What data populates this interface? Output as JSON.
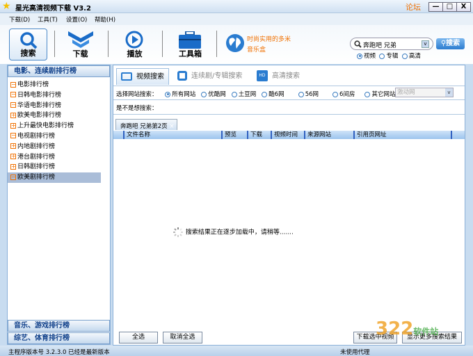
{
  "window": {
    "title": "星光高清视频下载 V3.2",
    "forum": "论坛",
    "minimize": "—",
    "maximize": "□",
    "close": "X"
  },
  "menu": [
    "下载(D)",
    "工具(T)",
    "设置(O)",
    "帮助(H)"
  ],
  "toolbar": {
    "search": "搜索",
    "download": "下载",
    "play": "播放",
    "toolbox": "工具箱",
    "promo_line1": "时尚实用的多米",
    "promo_line2": "音乐盒"
  },
  "search": {
    "value": "奔跑吧 兄弟",
    "button": "搜索",
    "types": [
      "视频",
      "专辑",
      "高清"
    ],
    "selected_type": "视频"
  },
  "sidebar": {
    "header_top": "电影、连续剧排行榜",
    "items": [
      {
        "label": "电影排行榜",
        "sign": "−"
      },
      {
        "label": "日韩电影排行榜",
        "sign": "−"
      },
      {
        "label": "华语电影排行榜",
        "sign": "−"
      },
      {
        "label": "欧美电影排行榜",
        "sign": "+"
      },
      {
        "label": "上升最快电影排行榜",
        "sign": "+"
      },
      {
        "label": "电视剧排行榜",
        "sign": "−"
      },
      {
        "label": "内地剧排行榜",
        "sign": "+"
      },
      {
        "label": "港台剧排行榜",
        "sign": "+"
      },
      {
        "label": "日韩剧排行榜",
        "sign": "+"
      },
      {
        "label": "欧美剧排行榜",
        "sign": "−"
      }
    ],
    "selected": "欧美剧排行榜",
    "header_music": "音乐、游戏排行榜",
    "header_variety": "综艺、体育排行榜"
  },
  "main": {
    "tabs": [
      "视频搜索",
      "连续剧/专辑搜索",
      "高清搜索"
    ],
    "site_label": "选择网站搜索：",
    "sites": [
      "所有网站",
      "优酷网",
      "土豆网",
      "酷6网",
      "56网",
      "6间房",
      "其它网站"
    ],
    "selected_site": "所有网站",
    "other_site_select": "激动网",
    "suggest_label": "是不是想搜索：",
    "result_tab": "奔跑吧 兄弟第2页",
    "columns": [
      "文件名称",
      "预览",
      "下载",
      "视频时间",
      "来源网站",
      "引用页网址"
    ],
    "loading": "搜索结果正在逐步加载中，请稍等.......",
    "select_all": "全选",
    "deselect_all": "取消全选",
    "download_selected": "下载选中视频",
    "show_more": "显示更多搜索结果"
  },
  "status": {
    "version": "主程序版本号 3.2.3.0  已经是最新版本",
    "proxy": "未使用代理"
  },
  "watermark": "3322软件站 .cc"
}
